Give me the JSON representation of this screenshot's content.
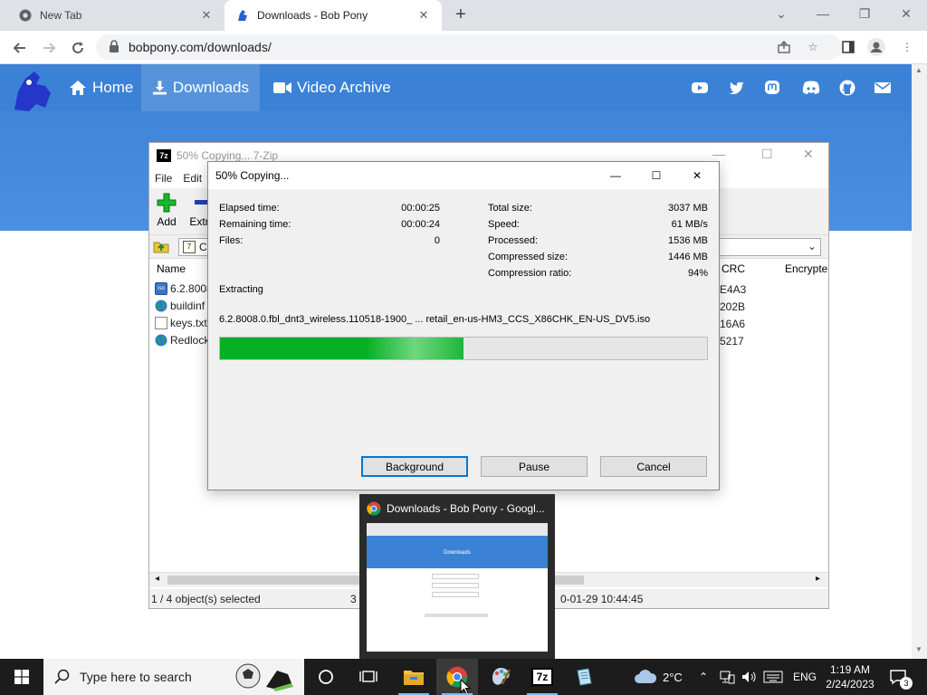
{
  "browser": {
    "tabs": [
      {
        "title": "New Tab",
        "active": false
      },
      {
        "title": "Downloads - Bob Pony",
        "active": true
      }
    ],
    "url": "bobpony.com/downloads/"
  },
  "site": {
    "nav": [
      {
        "label": "Home",
        "icon": "home-icon"
      },
      {
        "label": "Downloads",
        "icon": "download-icon"
      },
      {
        "label": "Video Archive",
        "icon": "video-icon"
      }
    ],
    "social_icons": [
      "youtube-icon",
      "twitter-icon",
      "mastodon-icon",
      "discord-icon",
      "github-icon",
      "mail-icon"
    ],
    "brand_color": "#3b82d6"
  },
  "file_manager": {
    "title": "50% Copying... 7-Zip",
    "menu": [
      "File",
      "Edit"
    ],
    "tools": [
      {
        "label": "Add"
      },
      {
        "label": "Extr"
      }
    ],
    "address_prefix": "C",
    "columns": {
      "name": "Name",
      "crc": "CRC",
      "encrypted": "Encrypte"
    },
    "rows": [
      {
        "name": "6.2.8008",
        "crc": "E4A3",
        "icon": "iso-icon"
      },
      {
        "name": "buildinf",
        "crc": "202B",
        "icon": "globe-icon"
      },
      {
        "name": "keys.txt",
        "crc": "16A6",
        "icon": "text-file-icon"
      },
      {
        "name": "Redlock",
        "crc": "5217",
        "icon": "globe-icon"
      }
    ],
    "status": {
      "selection": "1 / 4 object(s) selected",
      "size": "3",
      "modified": "0-01-29 10:44:45"
    }
  },
  "dialog": {
    "title": "50% Copying...",
    "left": [
      {
        "label": "Elapsed time:",
        "value": "00:00:25"
      },
      {
        "label": "Remaining time:",
        "value": "00:00:24"
      },
      {
        "label": "Files:",
        "value": "0"
      }
    ],
    "right": [
      {
        "label": "Total size:",
        "value": "3037 MB"
      },
      {
        "label": "Speed:",
        "value": "61 MB/s"
      },
      {
        "label": "Processed:",
        "value": "1536 MB"
      },
      {
        "label": "Compressed size:",
        "value": "1446 MB"
      },
      {
        "label": "Compression ratio:",
        "value": "94%"
      }
    ],
    "operation": "Extracting",
    "filename": "6.2.8008.0.fbl_dnt3_wireless.110518-1900_ ... retail_en-us-HM3_CCS_X86CHK_EN-US_DV5.iso",
    "progress_fraction": 0.5,
    "buttons": {
      "background": "Background",
      "pause": "Pause",
      "cancel": "Cancel"
    }
  },
  "thumbnail": {
    "title": "Downloads - Bob Pony - Googl...",
    "preview_heading": "Downloads"
  },
  "taskbar": {
    "search_placeholder": "Type here to search",
    "weather": "2°C",
    "language": "ENG",
    "time": "1:19 AM",
    "date": "2/24/2023",
    "notification_count": "3"
  }
}
